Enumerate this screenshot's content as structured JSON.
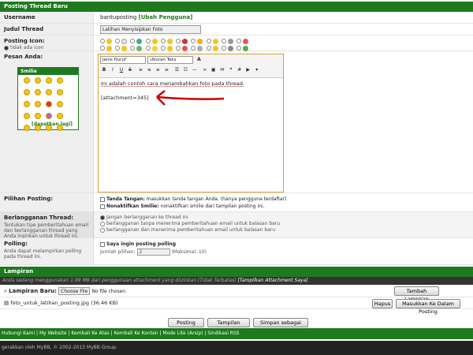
{
  "form": {
    "header": "Posting Thread Baru",
    "username_label": "Username",
    "username_value": "bantuposting",
    "username_change": "[Ubah Pengguna]",
    "subject_label": "Judul Thread",
    "subject_value": "Latihan Menyisipkan Foto",
    "icon_label": "Posting Icon:",
    "icon_none": "tidak ada icon",
    "message_label": "Pesan Anda:"
  },
  "smilies": {
    "title": "Smilie",
    "more": "[dapatkan lagi]"
  },
  "editor": {
    "font_label": "Jenis Huruf",
    "size_label": "Ukuran Teks",
    "text": "Ini adalah contoh cara menambahkan foto pada thread.",
    "attachment": "[attachment=345]"
  },
  "options": {
    "label": "Pilihan Posting:",
    "sig_title": "Tanda Tangan:",
    "sig_text": "masukkan tanda tangan Anda. (hanya pengguna terdaftar)",
    "smilie_title": "Nonaktifkan Smilie:",
    "smilie_text": "nonaktifkan smilie dari tampilan posting ini."
  },
  "subscribe": {
    "label": "Berlangganan Thread:",
    "desc": "Tentukan tipe pemberitahuan email dan berlangganan thread yang Anda inginkan untuk thread ini. (Hanya pengguna terdaftar)",
    "opt1": "Jangan berlangganan ke thread ini",
    "opt2": "berlangganan tanpa menerima pemberitahuan email untuk balasan baru",
    "opt3": "berlangganan dan menerima pemberitahuan email untuk balasan baru"
  },
  "polling": {
    "label": "Polling:",
    "desc": "Anda dapat melampirkan polling pada thread ini.",
    "check": "Saya ingin posting polling",
    "count_label": "Jumlah pilihan:",
    "count_value": "2",
    "max": "(Maksimal: 10)"
  },
  "attachments": {
    "header": "Lampiran",
    "usage": "Anda sedang menggunakan 1.99 MB dari penggunaan attachment yang diizinkan (Tidak Terbatas)",
    "view_link": "[Tampilkan Attachment Saya]",
    "new_label": "Lampiran Baru:",
    "choose": "Choose File",
    "no_file": "No file chosen",
    "add_button": "Tambah Lampiran",
    "file_name": "foto_untuk_latihan_posting.jpg (36.46 KB)",
    "delete_button": "Hapus",
    "insert_button": "Masukkan Ke Dalam Posting"
  },
  "actions": {
    "post": "Posting Thread",
    "preview": "Tampilan Posting",
    "draft": "Simpan sebagai naskah"
  },
  "footer": {
    "links": "Hubungi Kami | My Website | Kembali Ke Atas | Kembali Ke Konten | Mode Lite (Arsip) | Sindikasi RSS",
    "powered": "gerakkan oleh MyBB, © 2002-2013 MyBB Group."
  },
  "colors": {
    "brand": "#1e7a1e",
    "annotation": "#cc0000"
  }
}
